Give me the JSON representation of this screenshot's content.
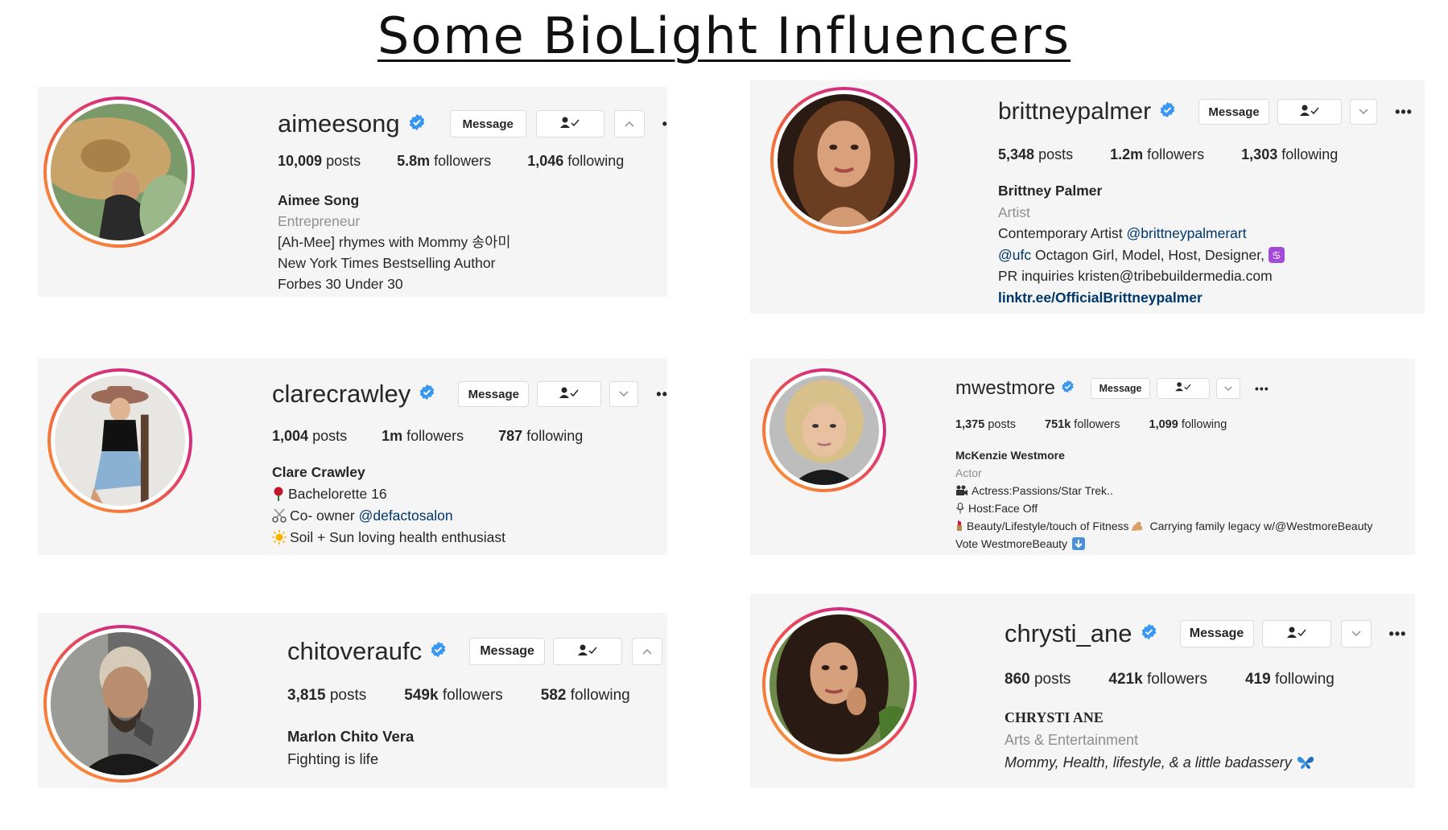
{
  "title": "Some BioLight Influencers",
  "ui": {
    "message_label": "Message",
    "more_label": "•••"
  },
  "colors": {
    "verified": "#3897f0",
    "link": "#00376b",
    "muted": "#8e8e8e",
    "card_bg": "#f5f5f5"
  },
  "profiles": [
    {
      "username": "aimeesong",
      "posts_num": "10,009",
      "posts_word": "posts",
      "followers_num": "5.8m",
      "followers_word": "followers",
      "following_num": "1,046",
      "following_word": "following",
      "name": "Aimee Song",
      "category": "Entrepreneur",
      "bio1": "[Ah-Mee] rhymes with Mommy 송아미",
      "bio2": "New York Times Bestselling Author",
      "bio3": "Forbes 30 Under 30",
      "chevron": "up"
    },
    {
      "username": "brittneypalmer",
      "posts_num": "5,348",
      "posts_word": "posts",
      "followers_num": "1.2m",
      "followers_word": "followers",
      "following_num": "1,303",
      "following_word": "following",
      "name": "Brittney Palmer",
      "category": "Artist",
      "bio1_text": "Contemporary Artist ",
      "bio1_link": "@brittneypalmerart",
      "bio2_link": "@ufc",
      "bio2_text": " Octagon Girl, Model, Host, Designer, ",
      "bio3": "PR inquiries kristen@tribebuildermedia.com",
      "website": "linktr.ee/OfficialBrittneypalmer",
      "chevron": "down"
    },
    {
      "username": "clarecrawley",
      "posts_num": "1,004",
      "posts_word": "posts",
      "followers_num": "1m",
      "followers_word": "followers",
      "following_num": "787",
      "following_word": "following",
      "name": "Clare Crawley",
      "bio1": "Bachelorette 16",
      "bio2_text": "Co- owner ",
      "bio2_link": "@defactosalon",
      "bio3": "Soil + Sun loving health enthusiast",
      "chevron": "down"
    },
    {
      "username": "mwestmore",
      "posts_num": "1,375",
      "posts_word": "posts",
      "followers_num": "751k",
      "followers_word": "followers",
      "following_num": "1,099",
      "following_word": "following",
      "name": "McKenzie Westmore",
      "category": "Actor",
      "bio1": "Actress:Passions/Star Trek..",
      "bio2": "Host:Face Off",
      "bio3a": "Beauty/Lifestyle/touch of Fitness",
      "bio3b": " Carrying family legacy w/@WestmoreBeauty",
      "bio4": "Vote WestmoreBeauty",
      "chevron": "down"
    },
    {
      "username": "chitoveraufc",
      "posts_num": "3,815",
      "posts_word": "posts",
      "followers_num": "549k",
      "followers_word": "followers",
      "following_num": "582",
      "following_word": "following",
      "name": "Marlon Chito Vera",
      "bio1": "Fighting is life",
      "chevron": "up"
    },
    {
      "username": "chrysti_ane",
      "posts_num": "860",
      "posts_word": "posts",
      "followers_num": "421k",
      "followers_word": "followers",
      "following_num": "419",
      "following_word": "following",
      "name": "CHRYSTI ANE",
      "category": "Arts & Entertainment",
      "bio1": "Mommy, Health, lifestyle, & a little badassery",
      "chevron": "down"
    }
  ]
}
